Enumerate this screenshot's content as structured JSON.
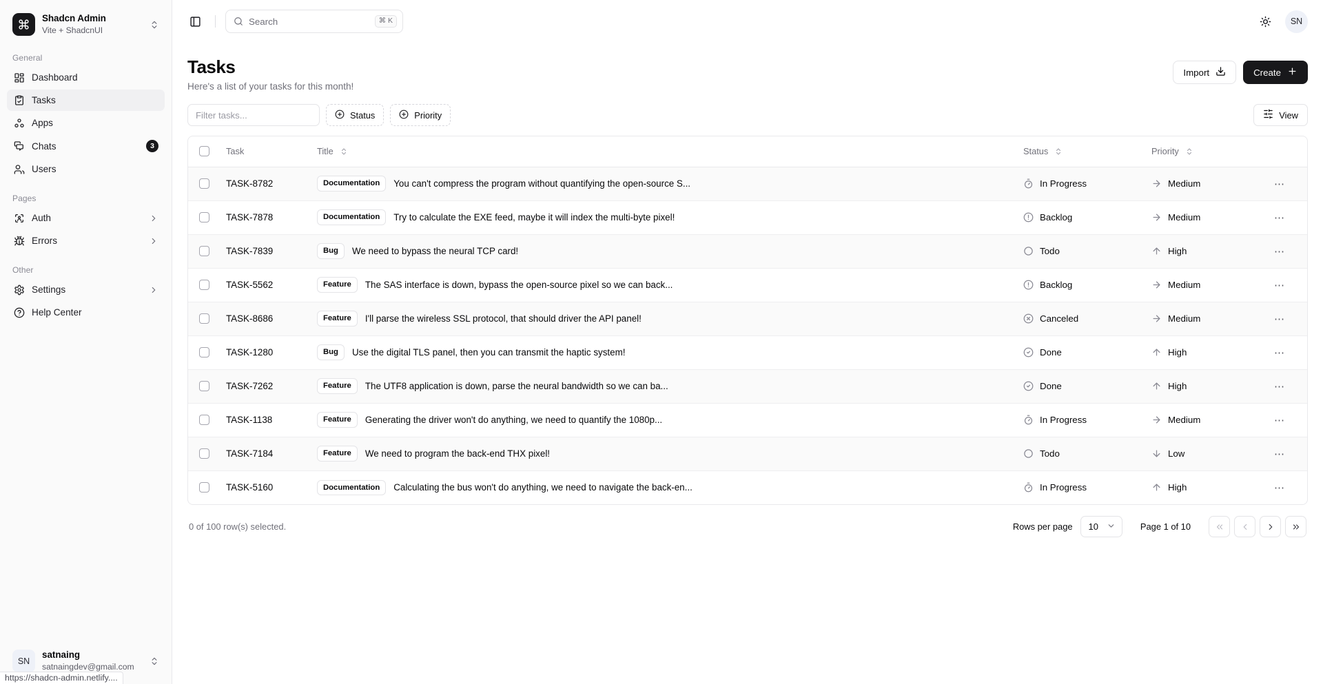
{
  "brand": {
    "logo_icon": "command-icon",
    "name": "Shadcn Admin",
    "subtitle": "Vite + ShadcnUI",
    "switcher_icon": "chevrons-up-down-icon"
  },
  "sidebar": {
    "groups": [
      {
        "label": "General",
        "items": [
          {
            "label": "Dashboard",
            "icon": "layout-dashboard-icon",
            "active": false,
            "badge": "",
            "chevron": false
          },
          {
            "label": "Tasks",
            "icon": "checklist-icon",
            "active": true,
            "badge": "",
            "chevron": false
          },
          {
            "label": "Apps",
            "icon": "packages-icon",
            "active": false,
            "badge": "",
            "chevron": false
          },
          {
            "label": "Chats",
            "icon": "messages-icon",
            "active": false,
            "badge": "3",
            "chevron": false
          },
          {
            "label": "Users",
            "icon": "users-icon",
            "active": false,
            "badge": "",
            "chevron": false
          }
        ]
      },
      {
        "label": "Pages",
        "items": [
          {
            "label": "Auth",
            "icon": "lock-access-icon",
            "active": false,
            "badge": "",
            "chevron": true
          },
          {
            "label": "Errors",
            "icon": "bug-icon",
            "active": false,
            "badge": "",
            "chevron": true
          }
        ]
      },
      {
        "label": "Other",
        "items": [
          {
            "label": "Settings",
            "icon": "gear-icon",
            "active": false,
            "badge": "",
            "chevron": true
          },
          {
            "label": "Help Center",
            "icon": "help-circle-icon",
            "active": false,
            "badge": "",
            "chevron": false
          }
        ]
      }
    ],
    "user": {
      "initials": "SN",
      "name": "satnaing",
      "email": "satnaingdev@gmail.com",
      "switcher_icon": "chevrons-up-down-icon"
    }
  },
  "status_bar": {
    "url": "https://shadcn-admin.netlify...."
  },
  "topbar": {
    "sidebar_toggle_icon": "panel-left-icon",
    "search": {
      "icon": "search-icon",
      "placeholder": "Search",
      "value": "",
      "shortcut": "⌘ K"
    },
    "theme_toggle_icon": "sun-icon",
    "avatar_initials": "SN"
  },
  "page": {
    "title": "Tasks",
    "subtitle": "Here's a list of your tasks for this month!",
    "import_label": "Import",
    "import_icon": "download-icon",
    "create_label": "Create",
    "create_icon": "plus-icon"
  },
  "toolbar": {
    "filter_placeholder": "Filter tasks...",
    "filter_value": "",
    "status_label": "Status",
    "priority_label": "Priority",
    "facet_icon": "circle-plus-icon",
    "view_label": "View",
    "view_icon": "sliders-icon"
  },
  "table": {
    "columns": [
      {
        "key": "select",
        "label": "",
        "sortable": false
      },
      {
        "key": "task",
        "label": "Task",
        "sortable": false
      },
      {
        "key": "title",
        "label": "Title",
        "sortable": true
      },
      {
        "key": "status",
        "label": "Status",
        "sortable": true
      },
      {
        "key": "priority",
        "label": "Priority",
        "sortable": true
      },
      {
        "key": "actions",
        "label": "",
        "sortable": false
      }
    ],
    "row_action_icon": "ellipsis-icon",
    "rows": [
      {
        "id": "TASK-8782",
        "tag": "Documentation",
        "title": "You can't compress the program without quantifying the open-source S...",
        "status": "In Progress",
        "status_icon": "timer-icon",
        "priority": "Medium",
        "priority_icon": "arrow-right-icon"
      },
      {
        "id": "TASK-7878",
        "tag": "Documentation",
        "title": "Try to calculate the EXE feed, maybe it will index the multi-byte pixel!",
        "status": "Backlog",
        "status_icon": "circle-help-icon",
        "priority": "Medium",
        "priority_icon": "arrow-right-icon"
      },
      {
        "id": "TASK-7839",
        "tag": "Bug",
        "title": "We need to bypass the neural TCP card!",
        "status": "Todo",
        "status_icon": "circle-icon",
        "priority": "High",
        "priority_icon": "arrow-up-icon"
      },
      {
        "id": "TASK-5562",
        "tag": "Feature",
        "title": "The SAS interface is down, bypass the open-source pixel so we can back...",
        "status": "Backlog",
        "status_icon": "circle-help-icon",
        "priority": "Medium",
        "priority_icon": "arrow-right-icon"
      },
      {
        "id": "TASK-8686",
        "tag": "Feature",
        "title": "I'll parse the wireless SSL protocol, that should driver the API panel!",
        "status": "Canceled",
        "status_icon": "circle-x-icon",
        "priority": "Medium",
        "priority_icon": "arrow-right-icon"
      },
      {
        "id": "TASK-1280",
        "tag": "Bug",
        "title": "Use the digital TLS panel, then you can transmit the haptic system!",
        "status": "Done",
        "status_icon": "circle-check-icon",
        "priority": "High",
        "priority_icon": "arrow-up-icon"
      },
      {
        "id": "TASK-7262",
        "tag": "Feature",
        "title": "The UTF8 application is down, parse the neural bandwidth so we can ba...",
        "status": "Done",
        "status_icon": "circle-check-icon",
        "priority": "High",
        "priority_icon": "arrow-up-icon"
      },
      {
        "id": "TASK-1138",
        "tag": "Feature",
        "title": "Generating the driver won't do anything, we need to quantify the 1080p...",
        "status": "In Progress",
        "status_icon": "timer-icon",
        "priority": "Medium",
        "priority_icon": "arrow-right-icon"
      },
      {
        "id": "TASK-7184",
        "tag": "Feature",
        "title": "We need to program the back-end THX pixel!",
        "status": "Todo",
        "status_icon": "circle-icon",
        "priority": "Low",
        "priority_icon": "arrow-down-icon"
      },
      {
        "id": "TASK-5160",
        "tag": "Documentation",
        "title": "Calculating the bus won't do anything, we need to navigate the back-en...",
        "status": "In Progress",
        "status_icon": "timer-icon",
        "priority": "High",
        "priority_icon": "arrow-up-icon"
      }
    ]
  },
  "pagination": {
    "rows_selected": "0 of 100 row(s) selected.",
    "rows_per_page_label": "Rows per page",
    "rows_per_page_value": "10",
    "page_info": "Page 1 of 10",
    "first_icon": "chevrons-left-icon",
    "prev_icon": "chevron-left-icon",
    "next_icon": "chevron-right-icon",
    "last_icon": "chevrons-right-icon"
  },
  "colors": {
    "accent": "#18181b",
    "sidebar_bg": "#fafafa",
    "border": "#e4e4e7",
    "muted_text": "#71717a"
  }
}
